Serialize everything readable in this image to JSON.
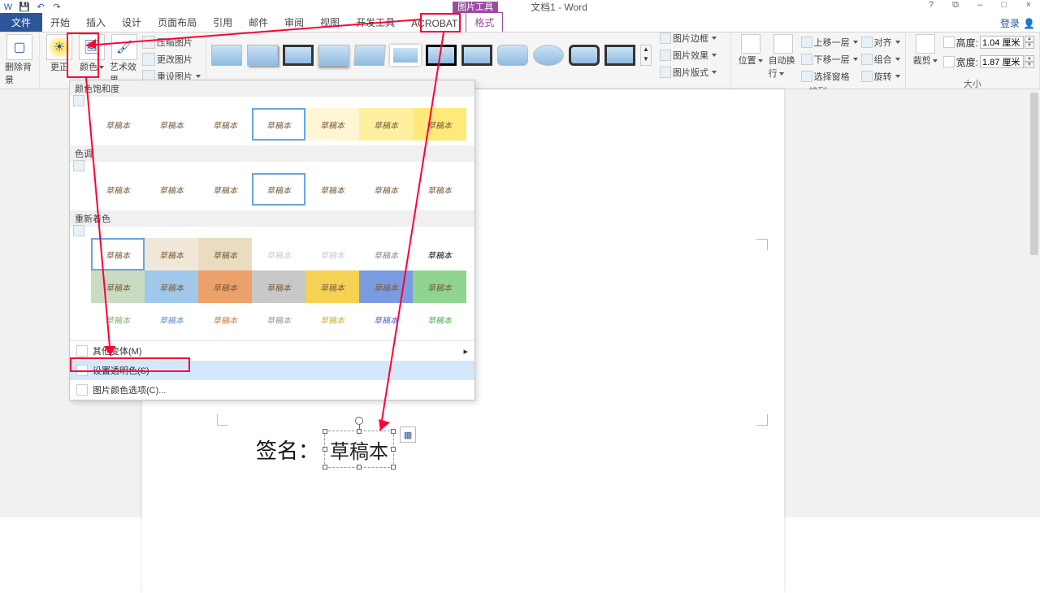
{
  "title": {
    "context_tool_label": "图片工具",
    "doc_title": "文档1 - Word"
  },
  "qat": {
    "word_icon": "W",
    "save_icon": "💾",
    "undo_icon": "↶",
    "redo_icon": "↷"
  },
  "wincontrols": {
    "help": "?",
    "ribbon_toggle": "⧉",
    "minimize": "–",
    "maximize": "□",
    "close": "×"
  },
  "tabs": {
    "file": "文件",
    "home": "开始",
    "insert": "插入",
    "design": "设计",
    "layout": "页面布局",
    "references": "引用",
    "mailings": "邮件",
    "review": "审阅",
    "view": "视图",
    "developer": "开发工具",
    "acrobat": "ACROBAT",
    "format": "格式"
  },
  "signin": "登录",
  "ribbon": {
    "remove_bg": "删除背景",
    "corrections": "更正",
    "color": "颜色",
    "artistic": "艺术效果",
    "compress": "压缩图片",
    "change": "更改图片",
    "reset": "重设图片",
    "border": "图片边框",
    "effects": "图片效果",
    "layout_style": "图片版式",
    "position": "位置",
    "wrap": "自动换行",
    "bring_fwd": "上移一层",
    "send_bwd": "下移一层",
    "selection_pane": "选择窗格",
    "align": "对齐",
    "group_btn": "组合",
    "rotate": "旋转",
    "crop": "裁剪",
    "height_label": "高度:",
    "height_value": "1.04 厘米",
    "width_label": "宽度:",
    "width_value": "1.87 厘米",
    "grp_arrange": "排列",
    "grp_size": "大小"
  },
  "color_popup": {
    "sec1": "颜色饱和度",
    "sec2": "色调",
    "sec3": "重新着色",
    "sample_text": "草稿本",
    "more_variations": "其他变体(M)",
    "set_transparent": "设置透明色(S)",
    "color_options": "图片颜色选项(C)..."
  },
  "document": {
    "sig_label": "签名：",
    "sig_text": "草稿本"
  }
}
